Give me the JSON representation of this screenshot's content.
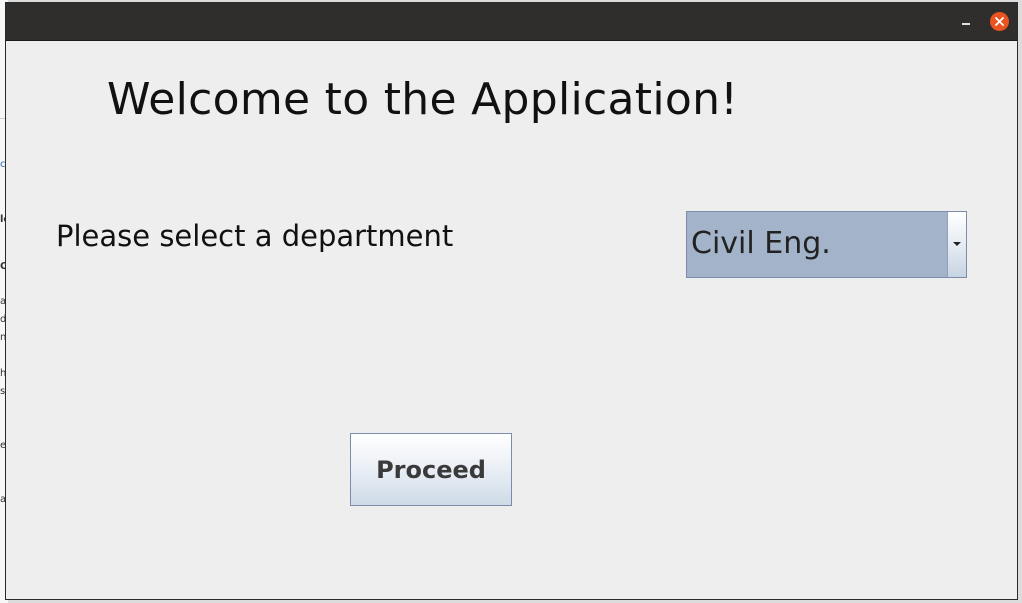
{
  "window": {
    "title": "",
    "controls": {
      "minimize_icon": "minimize-icon",
      "close_icon": "close-icon",
      "close_color": "#e95420"
    }
  },
  "main": {
    "welcome_title": "Welcome to the Application!",
    "prompt_label": "Please select a department",
    "department_select": {
      "selected_value": "Civil Eng.",
      "arrow_icon": "chevron-down-icon",
      "background_color": "#a3b3c9"
    },
    "proceed_label": "Proceed"
  },
  "background_app": {
    "visible_chars": [
      "c",
      "le",
      "Q",
      "a",
      "d",
      "n",
      "h",
      "s",
      "e",
      "a"
    ]
  }
}
